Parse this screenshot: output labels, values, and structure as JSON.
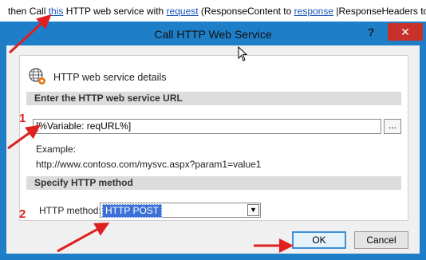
{
  "rule": {
    "prefix": "then Call ",
    "link_this": "this",
    "middle": " HTTP web service with ",
    "link_request": "request",
    "middle2": " (ResponseContent to ",
    "link_response": "response",
    "suffix": " |ResponseHeaders to re"
  },
  "dialog": {
    "title": "Call HTTP Web Service",
    "help_glyph": "?",
    "close_glyph": "✕",
    "details_heading": "HTTP web service details",
    "url_section_label": "Enter the HTTP web service URL",
    "url_value": "[%Variable: reqURL%]",
    "browse_label": "...",
    "example_label": "Example:",
    "example_value": "http://www.contoso.com/mysvc.aspx?param1=value1",
    "method_section_label": "Specify HTTP method",
    "method_label": "HTTP method:",
    "method_value": "HTTP POST",
    "ok_label": "OK",
    "cancel_label": "Cancel"
  },
  "annotations": {
    "marker_1": "1",
    "marker_2": "2",
    "color": "#e02020"
  },
  "colors": {
    "titlebar": "#1f7ec8",
    "close_button": "#c7312a",
    "link": "#1a55b8",
    "selection": "#3b71d6"
  }
}
